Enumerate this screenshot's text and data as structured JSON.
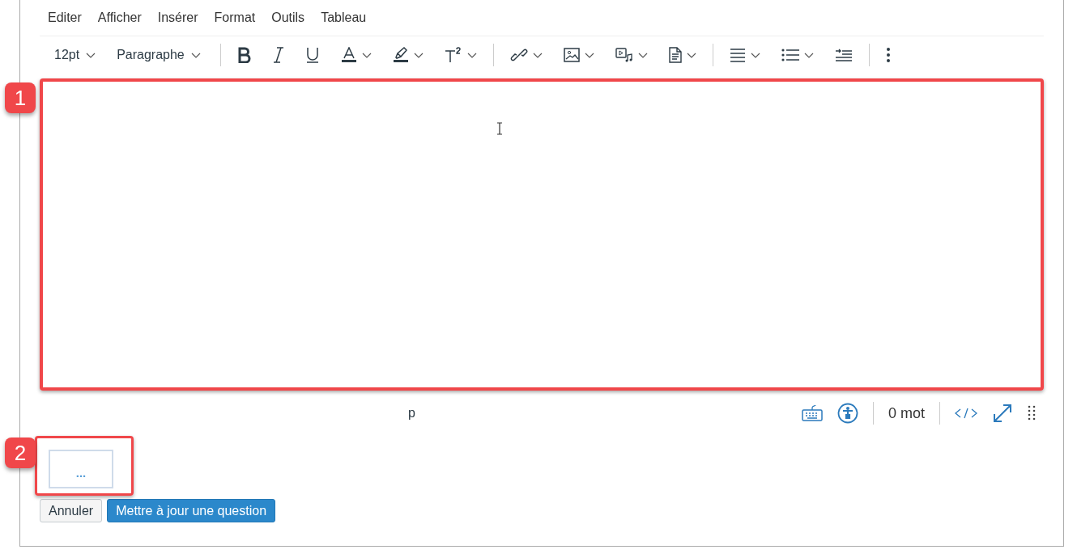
{
  "menu": [
    "Editer",
    "Afficher",
    "Insérer",
    "Format",
    "Outils",
    "Tableau"
  ],
  "toolbar": [
    [
      {
        "kind": "dropdown",
        "label": "12pt"
      },
      {
        "kind": "dropdown",
        "label": "Paragraphe"
      }
    ],
    [
      {
        "kind": "bold",
        "caret": false
      },
      {
        "kind": "italic",
        "caret": false
      },
      {
        "kind": "underline",
        "caret": false
      },
      {
        "kind": "textcolor",
        "caret": true
      },
      {
        "kind": "highlight",
        "caret": true
      },
      {
        "kind": "superscript",
        "caret": true
      }
    ],
    [
      {
        "kind": "link",
        "caret": true
      },
      {
        "kind": "image",
        "caret": true
      },
      {
        "kind": "media",
        "caret": true
      },
      {
        "kind": "document",
        "caret": true
      }
    ],
    [
      {
        "kind": "align",
        "caret": true
      },
      {
        "kind": "list",
        "caret": true
      },
      {
        "kind": "indent",
        "caret": false
      }
    ],
    [
      {
        "kind": "more",
        "caret": false
      }
    ]
  ],
  "editor": {
    "callout": "1",
    "highlighted": true
  },
  "status_bar": {
    "path": "p",
    "word_count": "0 mot"
  },
  "comment": {
    "callout": "2",
    "highlighted": true,
    "text": "..."
  },
  "buttons": [
    {
      "label": "Annuler",
      "kind": "secondary"
    },
    {
      "label": "Mettre à jour une question",
      "kind": "primary"
    }
  ]
}
